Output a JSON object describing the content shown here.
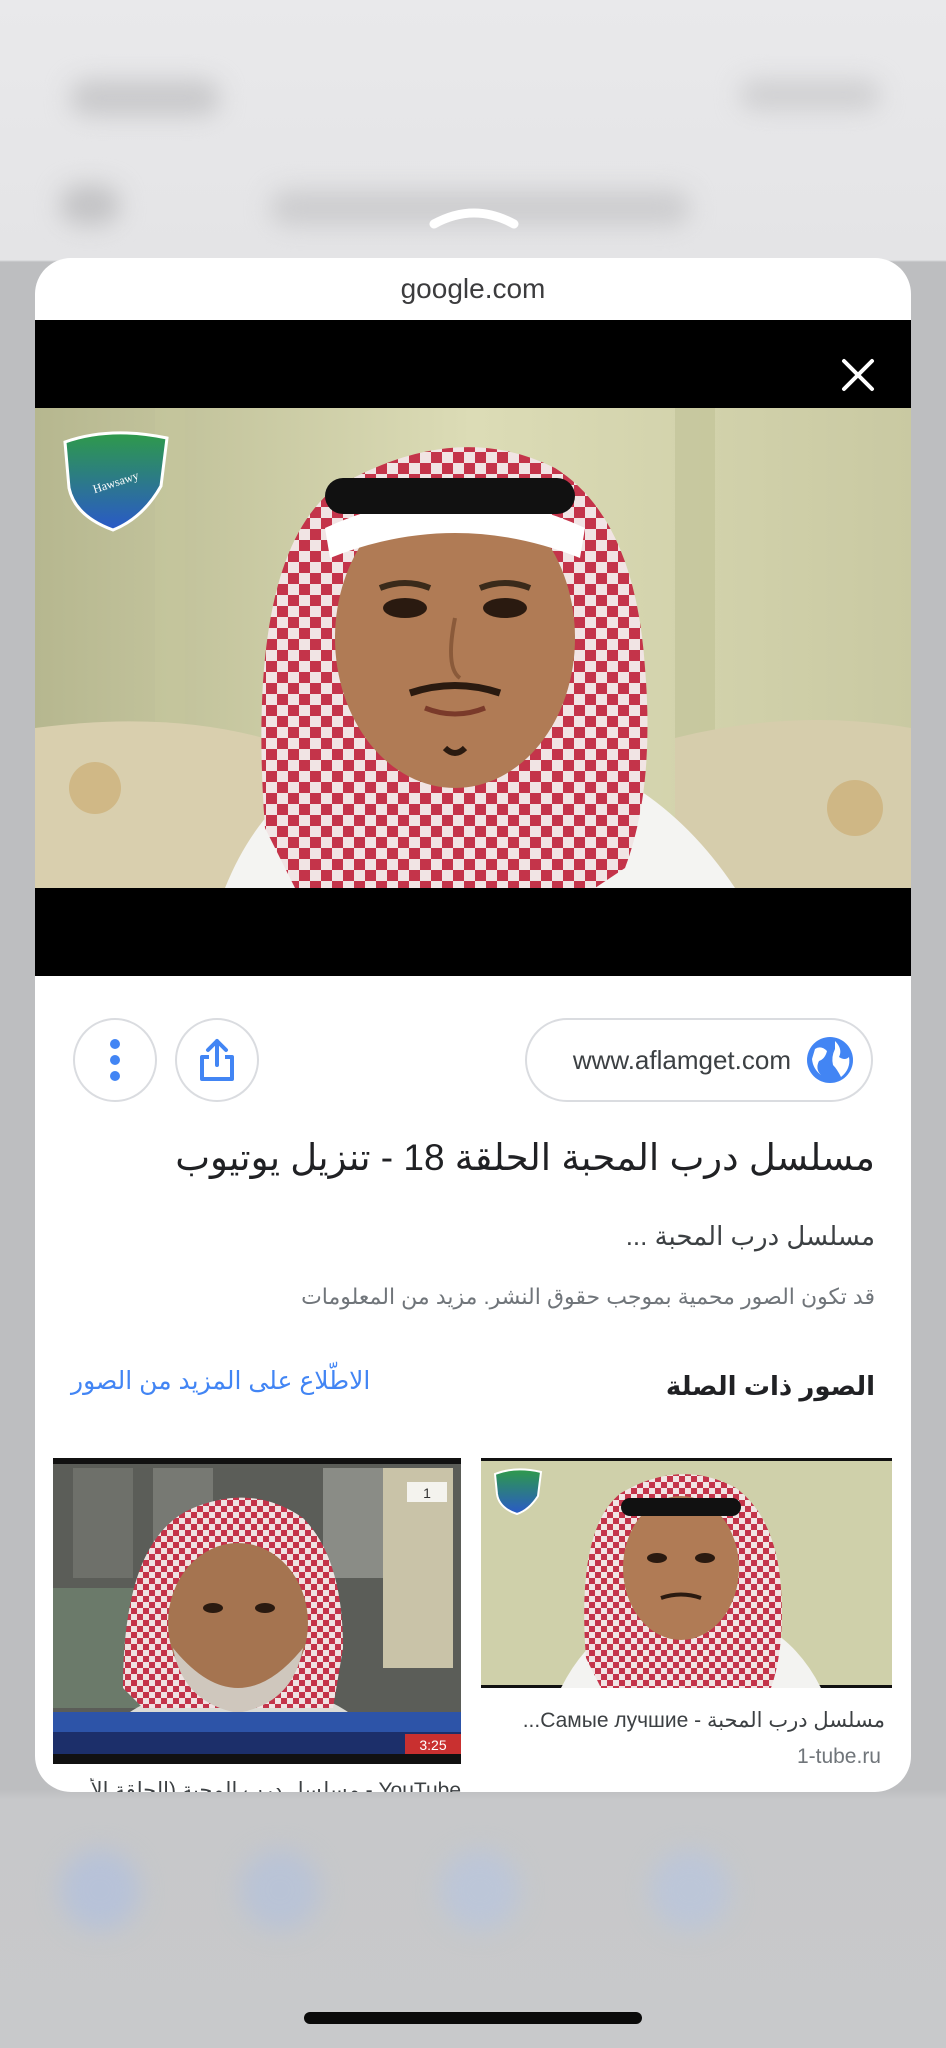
{
  "sheet": {
    "domain": "google.com"
  },
  "viewer": {
    "close_icon": "close-icon",
    "watermark_text": "Hawsawy"
  },
  "actions": {
    "more_icon": "more-vert-icon",
    "share_icon": "share-icon",
    "site_url": "www.aflamget.com",
    "globe_icon": "globe-icon"
  },
  "result": {
    "title": "مسلسل درب المحبة الحلقة 18 - تنزيل يوتيوب",
    "snippet": "مسلسل درب المحبة ...",
    "copyright_note": "قد تكون الصور محمية بموجب حقوق النشر. مزيد من المعلومات"
  },
  "related": {
    "header": "الصور ذات الصلة",
    "see_more": "الاطّلاع على المزيد من الصور",
    "items": [
      {
        "caption": "مسلسل درب المحبة - Самые лучшие...",
        "source": "1-tube.ru"
      },
      {
        "caption": "YouTube - مسلسل درب المحبة (الحلقة الأ",
        "ticker_time": "3:25",
        "ticker_label": "1"
      }
    ]
  },
  "colors": {
    "accent": "#4285f4",
    "keffiyeh_red": "#c4344a",
    "viewer_bg": "#000000"
  }
}
